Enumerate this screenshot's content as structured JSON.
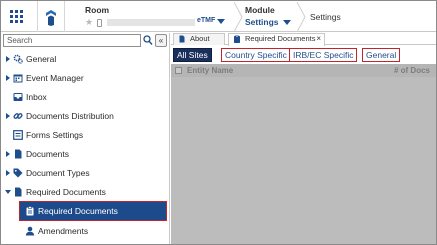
{
  "header": {
    "room_label": "Room",
    "room_tag": "eTMF",
    "module_label": "Module",
    "module_value": "Settings",
    "breadcrumb_current": "Settings"
  },
  "sidebar": {
    "search_placeholder": "Search",
    "collapse_glyph": "«",
    "items": [
      {
        "label": "General",
        "icon": "gears-icon",
        "expandable": true
      },
      {
        "label": "Event Manager",
        "icon": "calendar-icon",
        "expandable": true
      },
      {
        "label": "Inbox",
        "icon": "inbox-icon",
        "expandable": false
      },
      {
        "label": "Documents Distribution",
        "icon": "link-icon",
        "expandable": true
      },
      {
        "label": "Forms Settings",
        "icon": "form-icon",
        "expandable": false
      },
      {
        "label": "Documents",
        "icon": "document-icon",
        "expandable": true
      },
      {
        "label": "Document Types",
        "icon": "tag-icon",
        "expandable": true
      },
      {
        "label": "Required Documents",
        "icon": "document-icon",
        "expandable": true,
        "expanded": true
      },
      {
        "label": "Required Documents",
        "icon": "clipboard-icon",
        "child": true,
        "selected": true
      },
      {
        "label": "Amendments",
        "icon": "person-icon",
        "child": true
      }
    ]
  },
  "tabs": [
    {
      "label": "About",
      "icon": "document-icon"
    },
    {
      "label": "Required Documents",
      "icon": "clipboard-icon",
      "active": true,
      "close": "×"
    }
  ],
  "filters": [
    {
      "label": "All Sites",
      "active": true
    },
    {
      "label": "Country Specific"
    },
    {
      "label": "IRB/EC Specific"
    },
    {
      "label": "General"
    }
  ],
  "grid": {
    "columns": [
      "Entity Name",
      "# of Docs"
    ]
  },
  "colors": {
    "brand": "#1f4e8c",
    "selected": "#1d4a8a",
    "highlight": "#c0242c",
    "active_filter": "#1a2f5c"
  }
}
